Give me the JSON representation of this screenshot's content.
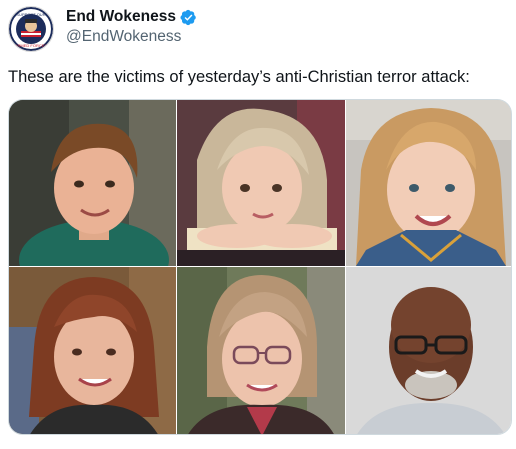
{
  "post": {
    "author": {
      "display_name": "End Wokeness",
      "handle": "@EndWokeness",
      "verified": true,
      "avatar_icon": "patriot-badge-avatar",
      "avatar_text_top": "SUPPORT OUR",
      "avatar_text_bottom": "ARMED FORCES"
    },
    "more_label": "···",
    "text": "These are the victims of yesterday’s anti-Christian terror attack:",
    "media": {
      "count": 6,
      "layout": "3x2 grid",
      "photos": [
        {
          "subject": "boy"
        },
        {
          "subject": "girl-resting-chin"
        },
        {
          "subject": "girl-smiling"
        },
        {
          "subject": "woman-red-hair"
        },
        {
          "subject": "woman-glasses"
        },
        {
          "subject": "man-glasses"
        }
      ]
    }
  },
  "colors": {
    "accent_blue": "#1d9bf0",
    "text_primary": "#0f1419",
    "text_secondary": "#536471",
    "border": "#cfd9de"
  }
}
